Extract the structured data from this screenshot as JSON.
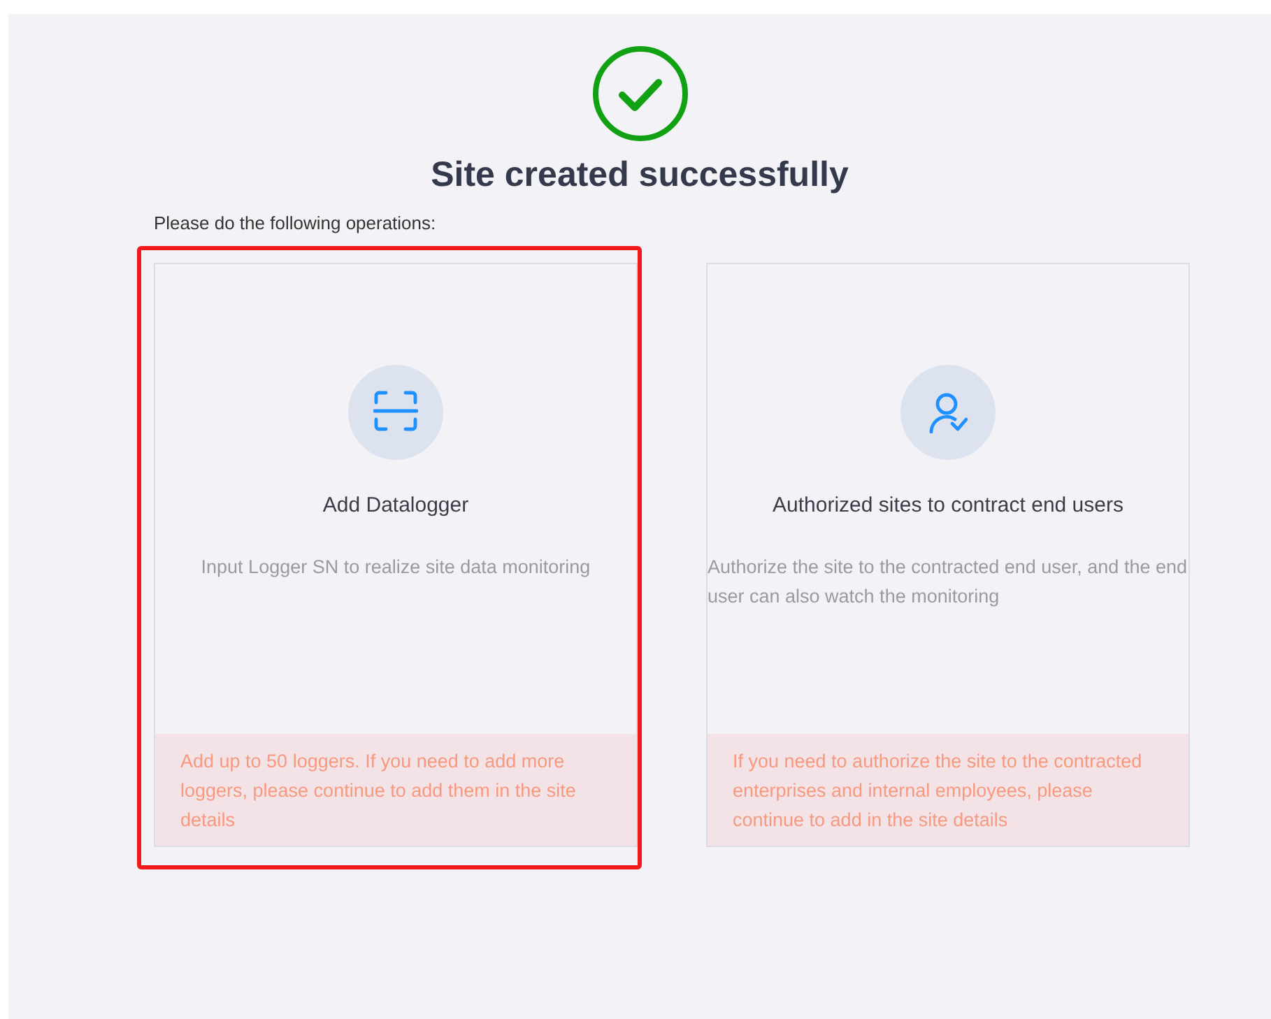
{
  "title": "Site created successfully",
  "instruction": "Please do the following operations:",
  "cards": [
    {
      "kind": "scan",
      "title": "Add Datalogger",
      "description": "Input Logger SN to realize site data monitoring",
      "note": "Add up to 50 loggers. If you need to add more loggers, please continue to add them in the site details",
      "highlighted": true
    },
    {
      "kind": "user",
      "title": "Authorized sites to contract end users",
      "description": "Authorize the site to the contracted end user, and the end user can also watch the monitoring",
      "note": "If you need to authorize the site to the contracted enterprises and internal employees, please continue to add in the site details",
      "highlighted": false
    }
  ]
}
